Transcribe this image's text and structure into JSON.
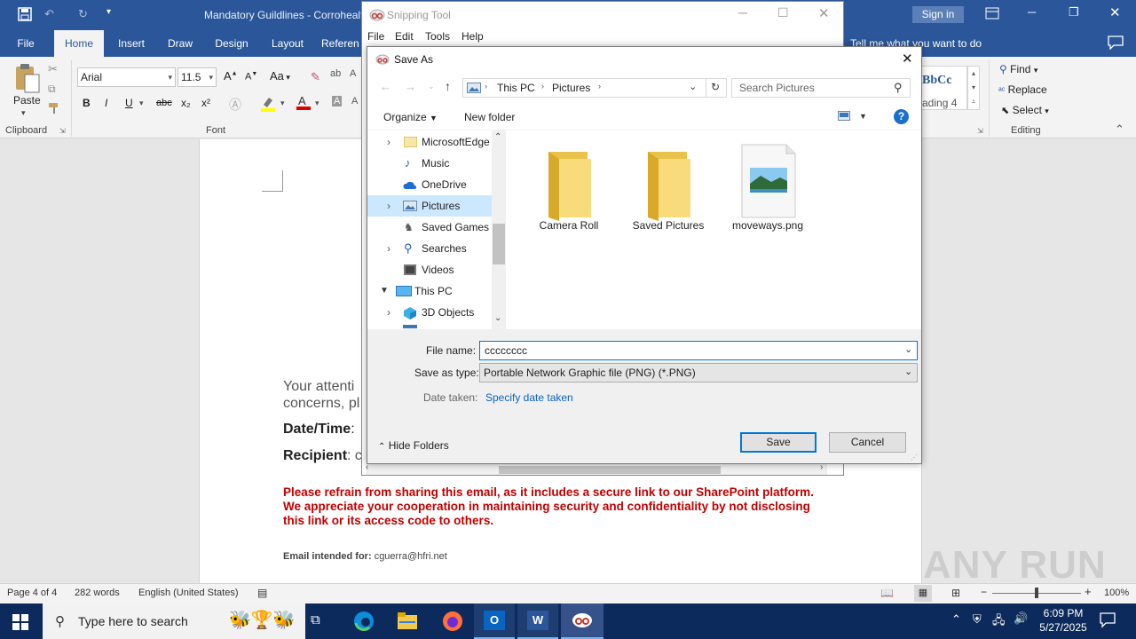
{
  "word": {
    "doc_title": "Mandatory Guildlines - Corrohealt",
    "sign_in": "Sign in",
    "tabs": [
      "File",
      "Home",
      "Insert",
      "Draw",
      "Design",
      "Layout",
      "Referen"
    ],
    "tell_me": "Tell me what you want to do",
    "font_name": "Arial",
    "font_size": "11.5",
    "paste_label": "Paste",
    "clipboard_label": "Clipboard",
    "font_group_label": "Font",
    "editing_label": "Editing",
    "find_label": "Find",
    "replace_label": "Replace",
    "select_label": "Select",
    "style_preview": "BbCc",
    "style_name": "ading 4",
    "format_buttons": [
      "B",
      "I",
      "U",
      "abc",
      "x₂",
      "x²"
    ],
    "aa_label": "Aa",
    "grow_font": "A",
    "shrink_font": "A"
  },
  "document": {
    "line1": "Your attenti",
    "line2": "concerns, pl",
    "datetime_label": "Date/Time",
    "datetime_colon": ":",
    "recipient_label": "Recipient",
    "recipient_colon": ": c",
    "warning_line1": "Please refrain from sharing this email, as it includes a secure link to our SharePoint platform.",
    "warning_line2": "We appreciate your cooperation in maintaining security and confidentiality by not disclosing",
    "warning_line3": "this link or its access code to others.",
    "intended_label": "Email intended for:",
    "intended_email": "cguerra@hfri.net"
  },
  "status": {
    "page": "Page 4 of 4",
    "words": "282 words",
    "language": "English (United States)",
    "zoom": "100%"
  },
  "taskbar": {
    "search_placeholder": "Type here to search",
    "time": "6:09 PM",
    "date": "5/27/2025"
  },
  "snipping_tool": {
    "title": "Snipping Tool",
    "menu": [
      "File",
      "Edit",
      "Tools",
      "Help"
    ]
  },
  "save_as": {
    "title": "Save As",
    "breadcrumb": [
      "This PC",
      "Pictures"
    ],
    "search_placeholder": "Search Pictures",
    "organize": "Organize",
    "new_folder": "New folder",
    "tree": [
      {
        "label": "MicrosoftEdge",
        "icon": "folder-icon",
        "expander": "›"
      },
      {
        "label": "Music",
        "icon": "music-icon",
        "expander": ""
      },
      {
        "label": "OneDrive",
        "icon": "onedrive-icon",
        "expander": ""
      },
      {
        "label": "Pictures",
        "icon": "pictures-icon",
        "expander": "›"
      },
      {
        "label": "Saved Games",
        "icon": "games-icon",
        "expander": ""
      },
      {
        "label": "Searches",
        "icon": "search-icon",
        "expander": "›"
      },
      {
        "label": "Videos",
        "icon": "videos-icon",
        "expander": ""
      },
      {
        "label": "This PC",
        "icon": "pc-icon",
        "expander": "⌄"
      },
      {
        "label": "3D Objects",
        "icon": "cube-icon",
        "expander": "›"
      }
    ],
    "selected_tree_item": "Pictures",
    "files": [
      {
        "name": "Camera Roll",
        "type": "folder"
      },
      {
        "name": "Saved Pictures",
        "type": "folder"
      },
      {
        "name": "moveways.png",
        "type": "image"
      }
    ],
    "file_name_label": "File name:",
    "file_name_value": "cccccccc",
    "save_type_label": "Save as type:",
    "save_type_value": "Portable Network Graphic file (PNG) (*.PNG)",
    "date_taken_label": "Date taken:",
    "date_taken_value": "Specify date taken",
    "hide_folders": "Hide Folders",
    "save": "Save",
    "cancel": "Cancel"
  },
  "colors": {
    "word_blue": "#2b579a",
    "warning_red": "#c00000",
    "link_blue": "#0b63c5",
    "taskbar": "#0d2a5c"
  },
  "watermark": "ANY RUN"
}
